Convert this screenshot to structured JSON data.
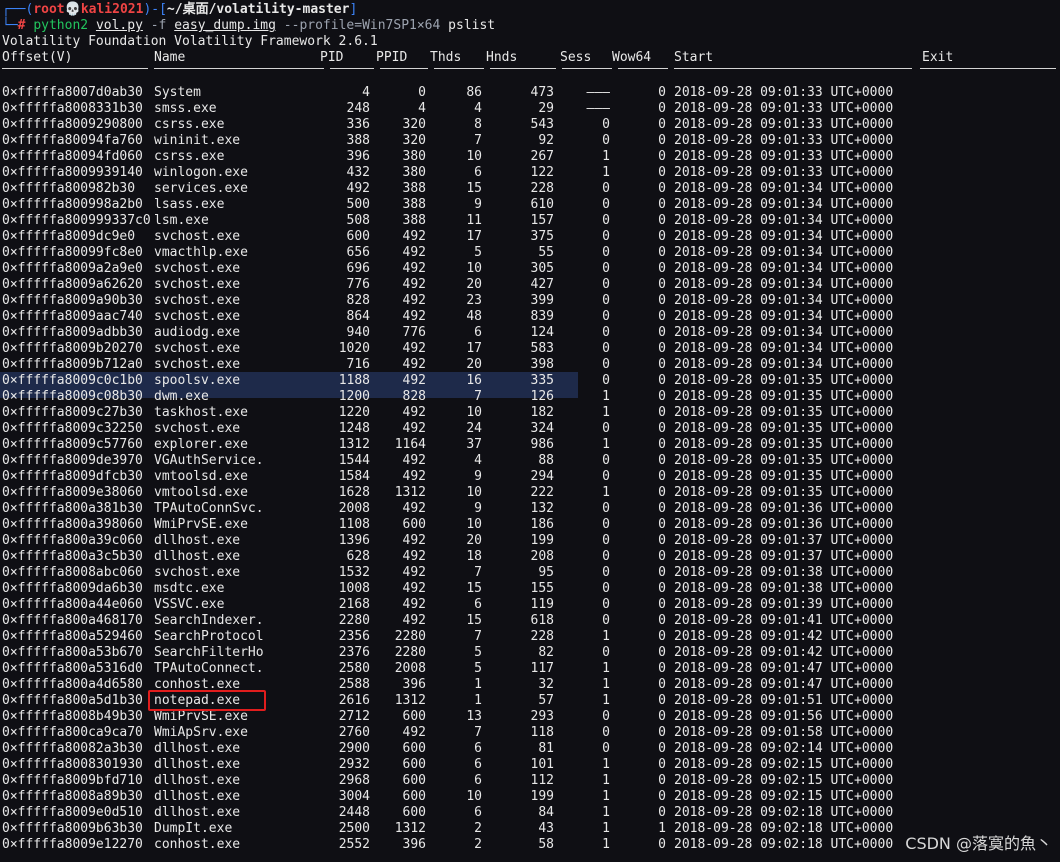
{
  "prompt": {
    "user": "root",
    "skull": "💀",
    "host": "kali2021",
    "path": "~/桌面/volatility-master",
    "hash": "#",
    "command": "python2",
    "script": "vol.py",
    "flag_f": "-f",
    "image": "easy_dump.img",
    "profile": "--profile=Win7SP1×64",
    "plugin": "pslist"
  },
  "framework_title": "Volatility Foundation Volatility Framework 2.6.1",
  "columns": [
    "Offset(V)",
    "Name",
    "PID",
    "PPID",
    "Thds",
    "Hnds",
    "Sess",
    "Wow64",
    "Start",
    "Exit"
  ],
  "rows": [
    [
      "0×fffffa8007d0ab30",
      "System",
      "4",
      "0",
      "86",
      "473",
      "———",
      "0",
      "2018-09-28 09:01:33 UTC+0000"
    ],
    [
      "0×fffffa8008331b30",
      "smss.exe",
      "248",
      "4",
      "4",
      "29",
      "———",
      "0",
      "2018-09-28 09:01:33 UTC+0000"
    ],
    [
      "0×fffffa8009290800",
      "csrss.exe",
      "336",
      "320",
      "8",
      "543",
      "0",
      "0",
      "2018-09-28 09:01:33 UTC+0000"
    ],
    [
      "0×fffffa80094fa760",
      "wininit.exe",
      "388",
      "320",
      "7",
      "92",
      "0",
      "0",
      "2018-09-28 09:01:33 UTC+0000"
    ],
    [
      "0×fffffa80094fd060",
      "csrss.exe",
      "396",
      "380",
      "10",
      "267",
      "1",
      "0",
      "2018-09-28 09:01:33 UTC+0000"
    ],
    [
      "0×fffffa8009939140",
      "winlogon.exe",
      "432",
      "380",
      "6",
      "122",
      "1",
      "0",
      "2018-09-28 09:01:33 UTC+0000"
    ],
    [
      "0×fffffa800982b30",
      "services.exe",
      "492",
      "388",
      "15",
      "228",
      "0",
      "0",
      "2018-09-28 09:01:34 UTC+0000"
    ],
    [
      "0×fffffa800998a2b0",
      "lsass.exe",
      "500",
      "388",
      "9",
      "610",
      "0",
      "0",
      "2018-09-28 09:01:34 UTC+0000"
    ],
    [
      "0×fffffa800999337c0",
      "lsm.exe",
      "508",
      "388",
      "11",
      "157",
      "0",
      "0",
      "2018-09-28 09:01:34 UTC+0000"
    ],
    [
      "0×fffffa8009dc9e0",
      "svchost.exe",
      "600",
      "492",
      "17",
      "375",
      "0",
      "0",
      "2018-09-28 09:01:34 UTC+0000"
    ],
    [
      "0×fffffa80099fc8e0",
      "vmacthlp.exe",
      "656",
      "492",
      "5",
      "55",
      "0",
      "0",
      "2018-09-28 09:01:34 UTC+0000"
    ],
    [
      "0×fffffa8009a2a9e0",
      "svchost.exe",
      "696",
      "492",
      "10",
      "305",
      "0",
      "0",
      "2018-09-28 09:01:34 UTC+0000"
    ],
    [
      "0×fffffa8009a62620",
      "svchost.exe",
      "776",
      "492",
      "20",
      "427",
      "0",
      "0",
      "2018-09-28 09:01:34 UTC+0000"
    ],
    [
      "0×fffffa8009a90b30",
      "svchost.exe",
      "828",
      "492",
      "23",
      "399",
      "0",
      "0",
      "2018-09-28 09:01:34 UTC+0000"
    ],
    [
      "0×fffffa8009aac740",
      "svchost.exe",
      "864",
      "492",
      "48",
      "839",
      "0",
      "0",
      "2018-09-28 09:01:34 UTC+0000"
    ],
    [
      "0×fffffa8009adbb30",
      "audiodg.exe",
      "940",
      "776",
      "6",
      "124",
      "0",
      "0",
      "2018-09-28 09:01:34 UTC+0000"
    ],
    [
      "0×fffffa8009b20270",
      "svchost.exe",
      "1020",
      "492",
      "17",
      "583",
      "0",
      "0",
      "2018-09-28 09:01:34 UTC+0000"
    ],
    [
      "0×fffffa8009b712a0",
      "svchost.exe",
      "716",
      "492",
      "20",
      "398",
      "0",
      "0",
      "2018-09-28 09:01:34 UTC+0000"
    ],
    [
      "0×fffffa8009c0c1b0",
      "spoolsv.exe",
      "1188",
      "492",
      "16",
      "335",
      "0",
      "0",
      "2018-09-28 09:01:35 UTC+0000"
    ],
    [
      "0×fffffa8009c08b30",
      "dwm.exe",
      "1200",
      "828",
      "7",
      "126",
      "1",
      "0",
      "2018-09-28 09:01:35 UTC+0000"
    ],
    [
      "0×fffffa8009c27b30",
      "taskhost.exe",
      "1220",
      "492",
      "10",
      "182",
      "1",
      "0",
      "2018-09-28 09:01:35 UTC+0000"
    ],
    [
      "0×fffffa8009c32250",
      "svchost.exe",
      "1248",
      "492",
      "24",
      "324",
      "0",
      "0",
      "2018-09-28 09:01:35 UTC+0000"
    ],
    [
      "0×fffffa8009c57760",
      "explorer.exe",
      "1312",
      "1164",
      "37",
      "986",
      "1",
      "0",
      "2018-09-28 09:01:35 UTC+0000"
    ],
    [
      "0×fffffa8009de3970",
      "VGAuthService.",
      "1544",
      "492",
      "4",
      "88",
      "0",
      "0",
      "2018-09-28 09:01:35 UTC+0000"
    ],
    [
      "0×fffffa8009dfcb30",
      "vmtoolsd.exe",
      "1584",
      "492",
      "9",
      "294",
      "0",
      "0",
      "2018-09-28 09:01:35 UTC+0000"
    ],
    [
      "0×fffffa8009e38060",
      "vmtoolsd.exe",
      "1628",
      "1312",
      "10",
      "222",
      "1",
      "0",
      "2018-09-28 09:01:35 UTC+0000"
    ],
    [
      "0×fffffa800a381b30",
      "TPAutoConnSvc.",
      "2008",
      "492",
      "9",
      "132",
      "0",
      "0",
      "2018-09-28 09:01:36 UTC+0000"
    ],
    [
      "0×fffffa800a398060",
      "WmiPrvSE.exe",
      "1108",
      "600",
      "10",
      "186",
      "0",
      "0",
      "2018-09-28 09:01:36 UTC+0000"
    ],
    [
      "0×fffffa800a39c060",
      "dllhost.exe",
      "1396",
      "492",
      "20",
      "199",
      "0",
      "0",
      "2018-09-28 09:01:37 UTC+0000"
    ],
    [
      "0×fffffa800a3c5b30",
      "dllhost.exe",
      "628",
      "492",
      "18",
      "208",
      "0",
      "0",
      "2018-09-28 09:01:37 UTC+0000"
    ],
    [
      "0×fffffa8008abc060",
      "svchost.exe",
      "1532",
      "492",
      "7",
      "95",
      "0",
      "0",
      "2018-09-28 09:01:38 UTC+0000"
    ],
    [
      "0×fffffa8009da6b30",
      "msdtc.exe",
      "1008",
      "492",
      "15",
      "155",
      "0",
      "0",
      "2018-09-28 09:01:38 UTC+0000"
    ],
    [
      "0×fffffa800a44e060",
      "VSSVC.exe",
      "2168",
      "492",
      "6",
      "119",
      "0",
      "0",
      "2018-09-28 09:01:39 UTC+0000"
    ],
    [
      "0×fffffa800a468170",
      "SearchIndexer.",
      "2280",
      "492",
      "15",
      "618",
      "0",
      "0",
      "2018-09-28 09:01:41 UTC+0000"
    ],
    [
      "0×fffffa800a529460",
      "SearchProtocol",
      "2356",
      "2280",
      "7",
      "228",
      "1",
      "0",
      "2018-09-28 09:01:42 UTC+0000"
    ],
    [
      "0×fffffa800a53b670",
      "SearchFilterHo",
      "2376",
      "2280",
      "5",
      "82",
      "0",
      "0",
      "2018-09-28 09:01:42 UTC+0000"
    ],
    [
      "0×fffffa800a5316d0",
      "TPAutoConnect.",
      "2580",
      "2008",
      "5",
      "117",
      "1",
      "0",
      "2018-09-28 09:01:47 UTC+0000"
    ],
    [
      "0×fffffa800a4d6580",
      "conhost.exe",
      "2588",
      "396",
      "1",
      "32",
      "1",
      "0",
      "2018-09-28 09:01:47 UTC+0000"
    ],
    [
      "0×fffffa800a5d1b30",
      "notepad.exe",
      "2616",
      "1312",
      "1",
      "57",
      "1",
      "0",
      "2018-09-28 09:01:51 UTC+0000"
    ],
    [
      "0×fffffa8008b49b30",
      "WmiPrvSE.exe",
      "2712",
      "600",
      "13",
      "293",
      "0",
      "0",
      "2018-09-28 09:01:56 UTC+0000"
    ],
    [
      "0×fffffa800ca9ca70",
      "WmiApSrv.exe",
      "2760",
      "492",
      "7",
      "118",
      "0",
      "0",
      "2018-09-28 09:01:58 UTC+0000"
    ],
    [
      "0×fffffa80082a3b30",
      "dllhost.exe",
      "2900",
      "600",
      "6",
      "81",
      "0",
      "0",
      "2018-09-28 09:02:14 UTC+0000"
    ],
    [
      "0×fffffa8008301930",
      "dllhost.exe",
      "2932",
      "600",
      "6",
      "101",
      "1",
      "0",
      "2018-09-28 09:02:15 UTC+0000"
    ],
    [
      "0×fffffa8009bfd710",
      "dllhost.exe",
      "2968",
      "600",
      "6",
      "112",
      "1",
      "0",
      "2018-09-28 09:02:15 UTC+0000"
    ],
    [
      "0×fffffa8008a89b30",
      "dllhost.exe",
      "3004",
      "600",
      "10",
      "199",
      "1",
      "0",
      "2018-09-28 09:02:15 UTC+0000"
    ],
    [
      "0×fffffa8009e0d510",
      "dllhost.exe",
      "2448",
      "600",
      "6",
      "84",
      "1",
      "0",
      "2018-09-28 09:02:18 UTC+0000"
    ],
    [
      "0×fffffa8009b63b30",
      "DumpIt.exe",
      "2500",
      "1312",
      "2",
      "43",
      "1",
      "1",
      "2018-09-28 09:02:18 UTC+0000"
    ],
    [
      "0×fffffa8009e12270",
      "conhost.exe",
      "2552",
      "396",
      "2",
      "58",
      "1",
      "0",
      "2018-09-28 09:02:18 UTC+0000"
    ]
  ],
  "highlighted_row": "notepad.exe",
  "watermark": "CSDN @落寞的魚丶"
}
